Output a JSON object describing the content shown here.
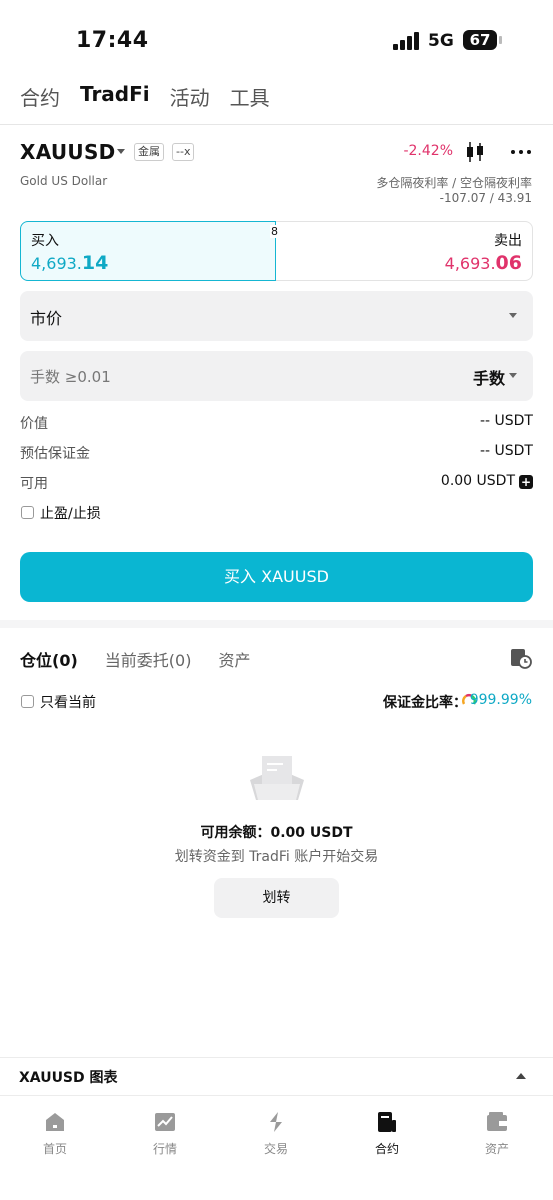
{
  "status": {
    "time": "17:44",
    "network": "5G",
    "battery": "67"
  },
  "top_tabs": [
    {
      "label": "合约",
      "active": false
    },
    {
      "label": "TradFi",
      "active": true
    },
    {
      "label": "活动",
      "active": false
    },
    {
      "label": "工具",
      "active": false
    }
  ],
  "instrument": {
    "symbol": "XAUUSD",
    "tag_category": "金属",
    "tag_leverage": "--x",
    "change": "-2.42%",
    "name": "Gold US Dollar",
    "rate_label": "多仓隔夜利率 / 空仓隔夜利率",
    "rate_value": "-107.07 / 43.91"
  },
  "quote": {
    "buy_label": "买入",
    "buy_price_main": "4,693.",
    "buy_price_tail": "14",
    "spread": "8",
    "sell_label": "卖出",
    "sell_price_main": "4,693.",
    "sell_price_tail": "06"
  },
  "order_type": {
    "value": "市价"
  },
  "quantity": {
    "placeholder": "手数 ≥0.01",
    "unit": "手数"
  },
  "info": [
    {
      "label": "价值",
      "value": "-- USDT"
    },
    {
      "label": "预估保证金",
      "value": "-- USDT"
    },
    {
      "label": "可用",
      "value": "0.00 USDT"
    }
  ],
  "tpsl_label": "止盈/止损",
  "buy_button": "买入 XAUUSD",
  "position_tabs": [
    {
      "label": "仓位(0)",
      "active": true
    },
    {
      "label": "当前委托(0)",
      "active": false
    },
    {
      "label": "资产",
      "active": false
    }
  ],
  "only_current_label": "只看当前",
  "margin_ratio": {
    "label": "保证金比率：",
    "value": "999.99%"
  },
  "empty": {
    "title": "可用余额：0.00 USDT",
    "subtitle": "划转资金到 TradFi 账户开始交易",
    "button": "划转"
  },
  "chart_bar": {
    "label": "XAUUSD  图表"
  },
  "bottom_nav": [
    {
      "label": "首页",
      "icon": "home-icon",
      "active": false
    },
    {
      "label": "行情",
      "icon": "market-icon",
      "active": false
    },
    {
      "label": "交易",
      "icon": "trade-icon",
      "active": false
    },
    {
      "label": "合约",
      "icon": "futures-icon",
      "active": true
    },
    {
      "label": "资产",
      "icon": "wallet-icon",
      "active": false
    }
  ],
  "colors": {
    "accent": "#0ab6d2",
    "sell": "#e0336b"
  }
}
